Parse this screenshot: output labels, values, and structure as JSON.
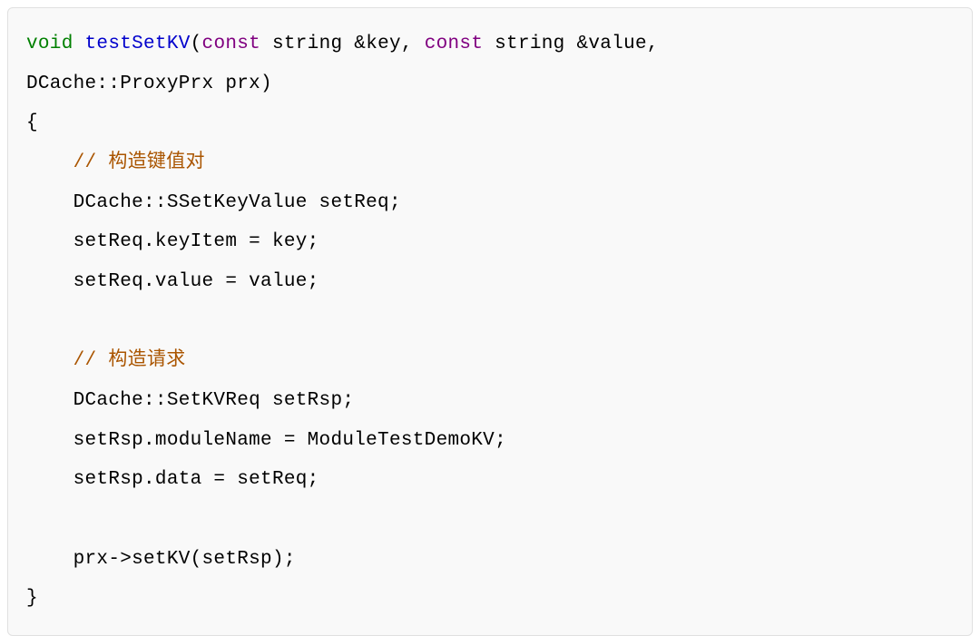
{
  "code": {
    "tokens": {
      "void": "void",
      "testSetKV": "testSetKV",
      "const1": "const",
      "string1": "string",
      "keyParam": "&key",
      "const2": "const",
      "string2": "string",
      "valueParam": "&value",
      "comma": ",",
      "line2": "DCache::ProxyPrx prx)",
      "openBrace": "{",
      "comment1": "// 构造键值对",
      "line4": "DCache::SSetKeyValue setReq;",
      "line5": "setReq.keyItem = key;",
      "line6": "setReq.value = value;",
      "comment2": "// 构造请求",
      "line8": "DCache::SetKVReq setRsp;",
      "line9": "setRsp.moduleName = ModuleTestDemoKV;",
      "line10": "setRsp.data = setReq;",
      "line11": "prx->setKV(setRsp);",
      "closeBrace": "}"
    }
  }
}
